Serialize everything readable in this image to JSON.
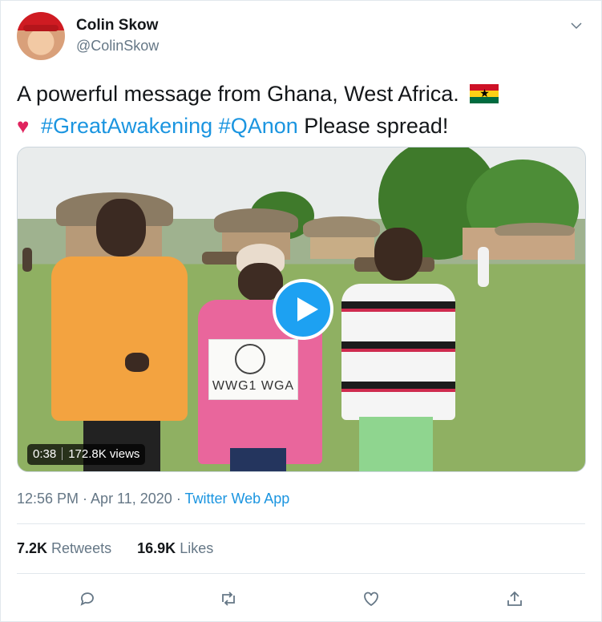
{
  "user": {
    "name": "Colin Skow",
    "handle": "@ColinSkow"
  },
  "tweet": {
    "text_before": "A powerful message from Ghana, West Africa.",
    "flag_icon": "ghana-flag-icon",
    "heart_icon": "pink-heart-icon",
    "hashtags": [
      "#GreatAwakening",
      "#QAnon"
    ],
    "text_after": "Please spread!"
  },
  "video": {
    "duration": "0:38",
    "views": "172.8K views",
    "sign_text": "WWG1 WGA",
    "play_icon": "play-icon"
  },
  "meta": {
    "time": "12:56 PM · Apr 11, 2020",
    "dot": "·",
    "app": "Twitter Web App"
  },
  "stats": {
    "retweets_count": "7.2K",
    "retweets_label": "Retweets",
    "likes_count": "16.9K",
    "likes_label": "Likes"
  },
  "colors": {
    "accent": "#1da1f2",
    "link": "#1b95e0",
    "muted": "#657786"
  }
}
